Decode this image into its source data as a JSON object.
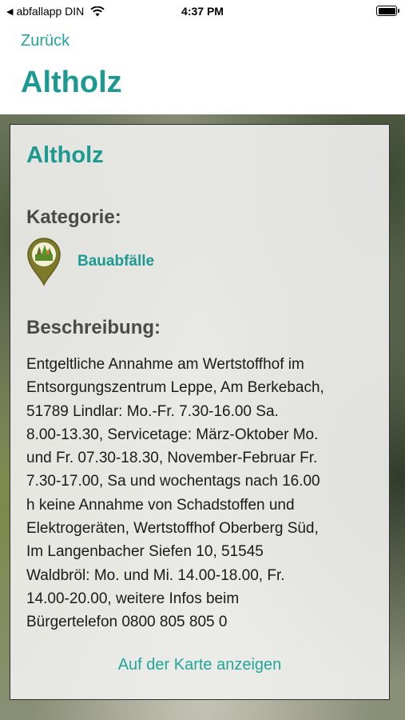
{
  "status_bar": {
    "back_app": "abfallapp DIN",
    "time": "4:37 PM",
    "battery_level": 1.0
  },
  "nav": {
    "back_label": "Zurück",
    "title": "Altholz"
  },
  "card": {
    "title": "Altholz",
    "category_label": "Kategorie:",
    "category_icon": "construction-waste-pin-icon",
    "category_name": "Bauabfälle",
    "description_label": "Beschreibung:",
    "description": "Entgeltliche Annahme am Wertstoffhof im\nEntsorgungszentrum Leppe, Am Berkebach,\n51789 Lindlar: Mo.-Fr. 7.30-16.00 Sa.\n8.00-13.30, Servicetage: März-Oktober Mo.\nund Fr. 07.30-18.30, November-Februar Fr.\n7.30-17.00,  Sa und wochentags nach 16.00\nh keine Annahme von Schadstoffen und\nElektrogeräten, Wertstoffhof Oberberg Süd,\nIm Langenbacher Siefen 10, 51545\nWaldbröl: Mo. und Mi. 14.00-18.00, Fr.\n14.00-20.00, weitere Infos beim\nBürgertelefon 0800 805 805 0",
    "map_link": "Auf der Karte anzeigen"
  },
  "colors": {
    "accent": "#1c9a91",
    "link": "#22a59b",
    "pin_olive": "#7d7a2a"
  }
}
